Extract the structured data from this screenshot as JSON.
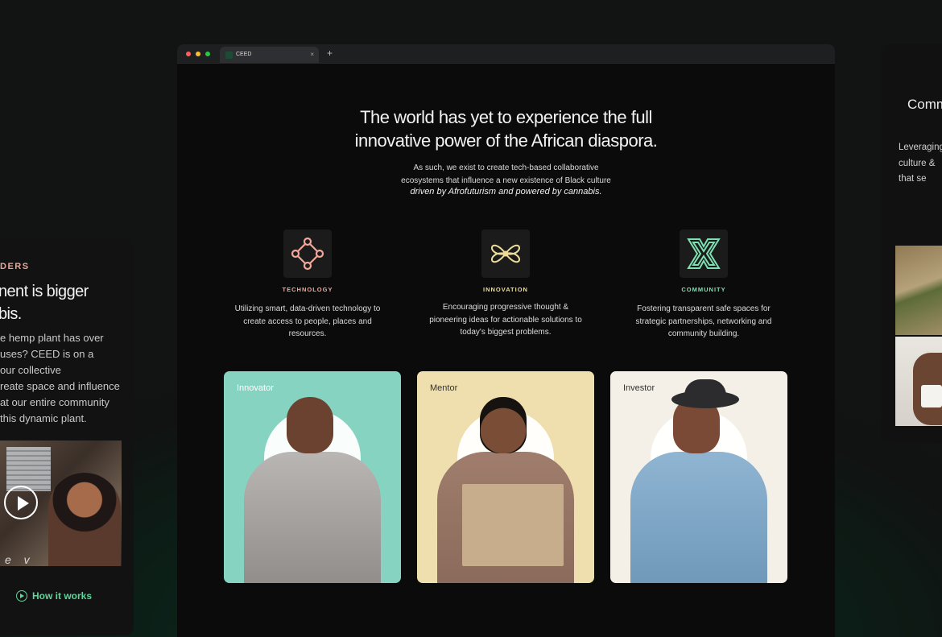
{
  "left_panel": {
    "eyebrow": "DERS",
    "title": "nent is bigger\nbis.",
    "body": "e hemp plant has over\n uses? CEED is on a\nour collective\nreate space and influence\nat our entire community\n this dynamic plant.",
    "video_caption": "e v",
    "cta": "How it works"
  },
  "right_panel": {
    "title": "Comm",
    "body": "Leveraging\nculture &\nthat se"
  },
  "browser": {
    "tab_title": "CEED",
    "tab_close": "×",
    "new_tab": "+"
  },
  "main": {
    "hero_line1": "The world has yet to experience the full",
    "hero_line2": "innovative power of the African diaspora.",
    "sub_line1": "As such, we exist to create tech-based collaborative",
    "sub_line2": "ecosystems that influence a new existence of Black culture",
    "sub_italic": "driven by Afrofuturism and powered by cannabis.",
    "features": [
      {
        "label": "TECHNOLOGY",
        "text": "Utilizing smart, data-driven technology to\ncreate access to people, places and\nresources.",
        "color": "#f2a79a",
        "icon": "technology-icon"
      },
      {
        "label": "INNOVATION",
        "text": "Encouraging progressive thought &\npioneering ideas for actionable solutions to\ntoday's biggest problems.",
        "color": "#eedc9a",
        "icon": "innovation-icon"
      },
      {
        "label": "COMMUNITY",
        "text": "Fostering transparent safe spaces for\nstrategic partnerships, networking and\ncommunity building.",
        "color": "#7fe0b2",
        "icon": "community-icon"
      }
    ],
    "cards": [
      {
        "label": "Innovator",
        "bg": "#86d3c2",
        "label_color": "#ffffff"
      },
      {
        "label": "Mentor",
        "bg": "#f0dfae",
        "label_color": "#333333"
      },
      {
        "label": "Investor",
        "bg": "#f5f0e7",
        "label_color": "#333333"
      }
    ]
  },
  "colors": {
    "accent_green": "#5fd59b",
    "coral": "#e8a79a"
  }
}
